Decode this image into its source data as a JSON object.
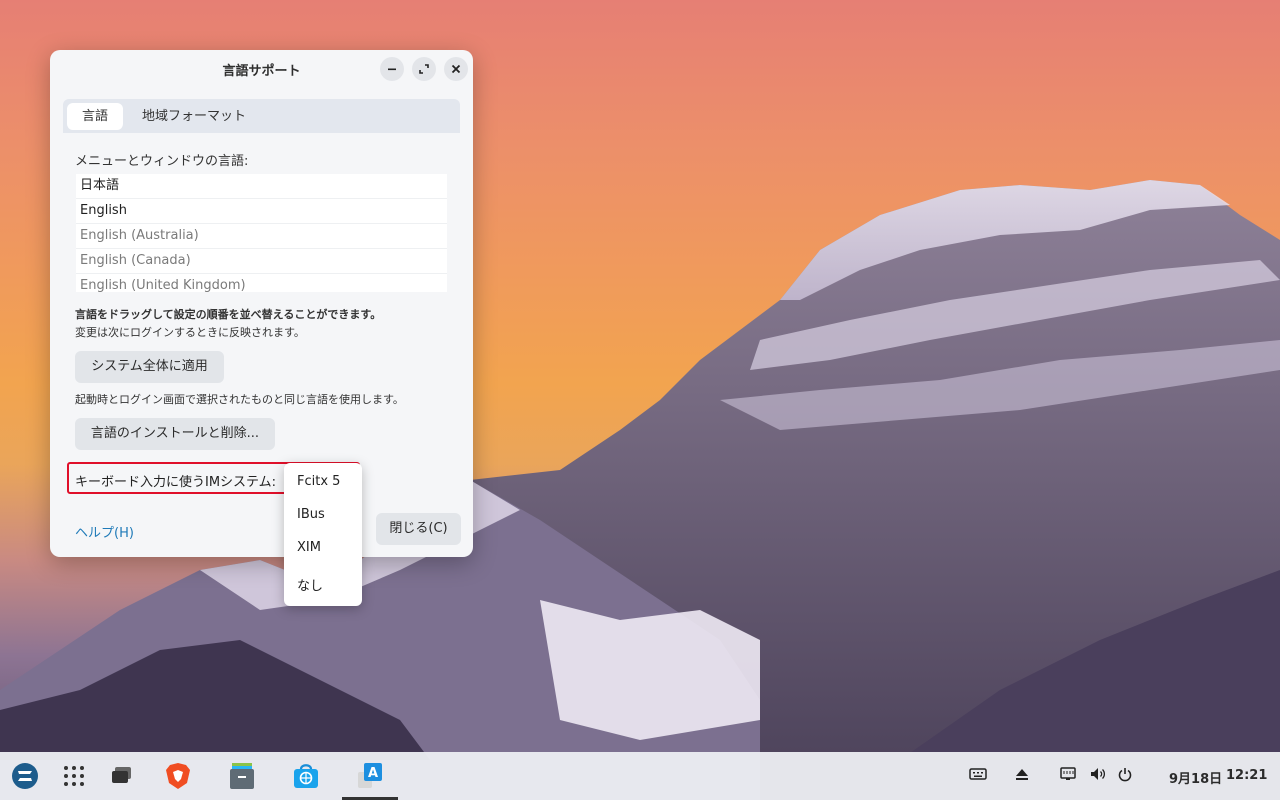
{
  "window": {
    "title": "言語サポート",
    "controls": {
      "minimize": "−",
      "maximize": "⤢",
      "close": "✕"
    }
  },
  "tabs": [
    {
      "label": "言語",
      "active": true
    },
    {
      "label": "地域フォーマット",
      "active": false
    }
  ],
  "languages": {
    "heading": "メニューとウィンドウの言語:",
    "items": [
      "日本語",
      "English",
      "English (Australia)",
      "English (Canada)",
      "English (United Kingdom)"
    ]
  },
  "notes": {
    "drag_hint": "言語をドラッグして設定の順番を並べ替えることができます。",
    "relogin_hint": "変更は次にログインするときに反映されます。",
    "apply_desc": "起動時とログイン画面で選択されたものと同じ言語を使用します。"
  },
  "buttons": {
    "apply_system_wide": "システム全体に適用",
    "install_remove": "言語のインストールと削除...",
    "help": "ヘルプ(H)",
    "close": "閉じる(C)"
  },
  "im_system": {
    "label": "キーボード入力に使うIMシステム:",
    "options": [
      "Fcitx 5",
      "IBus",
      "XIM",
      "なし"
    ],
    "selected": "Fcitx 5"
  },
  "taskbar": {
    "date": "9月18日",
    "time": "12:21",
    "apps": [
      "zorin-menu-icon",
      "app-grid-icon",
      "workspaces-icon",
      "brave-browser-icon",
      "files-icon",
      "software-store-icon",
      "language-support-icon"
    ],
    "tray": [
      "keyboard-icon",
      "eject-icon",
      "network-icon",
      "volume-icon",
      "power-icon"
    ]
  },
  "colors": {
    "highlight_border": "#e0102a",
    "link": "#1f7ab8"
  }
}
